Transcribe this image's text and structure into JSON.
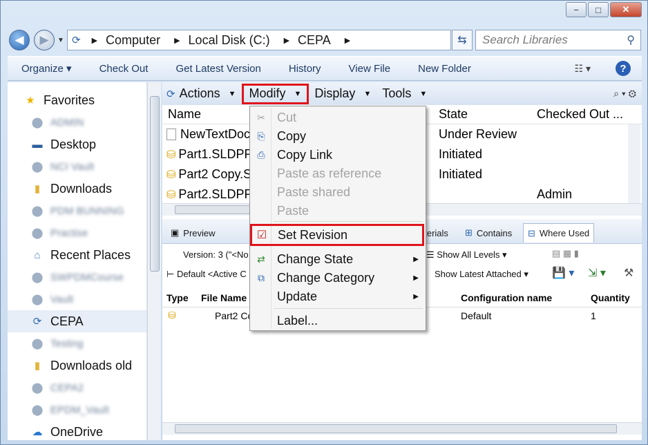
{
  "window": {
    "caption": {
      "min": "−",
      "max": "□",
      "close": "✕"
    }
  },
  "address": {
    "segments": [
      "Computer",
      "Local Disk (C:)",
      "CEPA"
    ],
    "search_placeholder": "Search Libraries"
  },
  "commands": [
    "Organize",
    "Check Out",
    "Get Latest Version",
    "History",
    "View File",
    "New Folder"
  ],
  "nav": {
    "favorites": "Favorites",
    "items": [
      {
        "label": "ADMIN",
        "blurred": true
      },
      {
        "label": "Desktop",
        "blurred": false
      },
      {
        "label": "NCI Vault",
        "blurred": true
      },
      {
        "label": "Downloads",
        "blurred": false
      },
      {
        "label": "PDM BUNNING",
        "blurred": true
      },
      {
        "label": "Practise",
        "blurred": true
      },
      {
        "label": "Recent Places",
        "blurred": false
      },
      {
        "label": "SWPDMCourse",
        "blurred": true
      },
      {
        "label": "Vault",
        "blurred": true
      },
      {
        "label": "CEPA",
        "blurred": false,
        "selected": true
      },
      {
        "label": "Testing",
        "blurred": true
      },
      {
        "label": "Downloads old",
        "blurred": false
      },
      {
        "label": "CEPA2",
        "blurred": true
      },
      {
        "label": "EPDM_Vault",
        "blurred": true
      },
      {
        "label": "OneDrive",
        "blurred": false
      }
    ]
  },
  "pdm_menu": {
    "actions": "Actions",
    "modify": "Modify",
    "display": "Display",
    "tools": "Tools"
  },
  "columns": {
    "name": "Name",
    "state": "State",
    "checked_out": "Checked Out ..."
  },
  "files": [
    {
      "name": "NewTextDoc",
      "state": "Under Review",
      "checked_out": ""
    },
    {
      "name": "Part1.SLDPR",
      "state": "Initiated",
      "checked_out": ""
    },
    {
      "name": "Part2 Copy.S",
      "state": "Initiated",
      "checked_out": ""
    },
    {
      "name": "Part2.SLDPR",
      "state": "",
      "checked_out": "Admin"
    }
  ],
  "bottom_tabs": {
    "preview": "Preview",
    "materials": "aterials",
    "contains": "Contains",
    "where_used": "Where Used"
  },
  "bottom_tools": {
    "version": "Version: 3 (\"<No",
    "default": "Default <Active C",
    "show_all_levels": "Show All Levels",
    "show_latest": "Show Latest Attached"
  },
  "bottom_table": {
    "headers": {
      "type": "Type",
      "file_name": "File Name",
      "config": "Configuration name",
      "qty": "Quantity"
    },
    "row": {
      "file_name": "Part2 Co",
      "config": "Default",
      "qty": "1"
    }
  },
  "context_menu": {
    "cut": "Cut",
    "copy": "Copy",
    "copy_link": "Copy Link",
    "paste_ref": "Paste as reference",
    "paste_shared": "Paste shared",
    "paste": "Paste",
    "set_revision": "Set Revision",
    "change_state": "Change State",
    "change_category": "Change Category",
    "update": "Update",
    "label": "Label..."
  }
}
